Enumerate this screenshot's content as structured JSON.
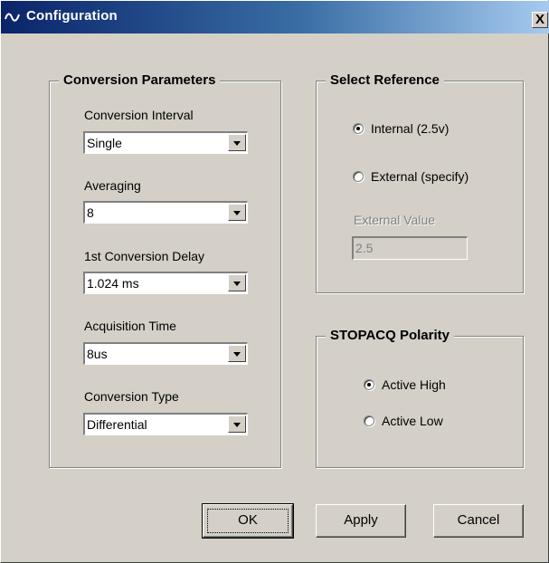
{
  "window": {
    "title": "Configuration",
    "close_label": "X"
  },
  "conversion_parameters": {
    "title": "Conversion Parameters",
    "conversion_interval": {
      "label": "Conversion Interval",
      "value": "Single"
    },
    "averaging": {
      "label": "Averaging",
      "value": "8"
    },
    "first_conversion_delay": {
      "label": "1st Conversion Delay",
      "value": "1.024 ms"
    },
    "acquisition_time": {
      "label": "Acquisition Time",
      "value": "8us"
    },
    "conversion_type": {
      "label": "Conversion Type",
      "value": "Differential"
    }
  },
  "select_reference": {
    "title": "Select Reference",
    "internal_label": "Internal (2.5v)",
    "external_label": "External (specify)",
    "selected": "internal",
    "external_value_label": "External Value",
    "external_value": "2.5"
  },
  "stopacq_polarity": {
    "title": "STOPACQ Polarity",
    "active_high_label": "Active High",
    "active_low_label": "Active Low",
    "selected": "active_high"
  },
  "buttons": {
    "ok": "OK",
    "apply": "Apply",
    "cancel": "Cancel"
  }
}
